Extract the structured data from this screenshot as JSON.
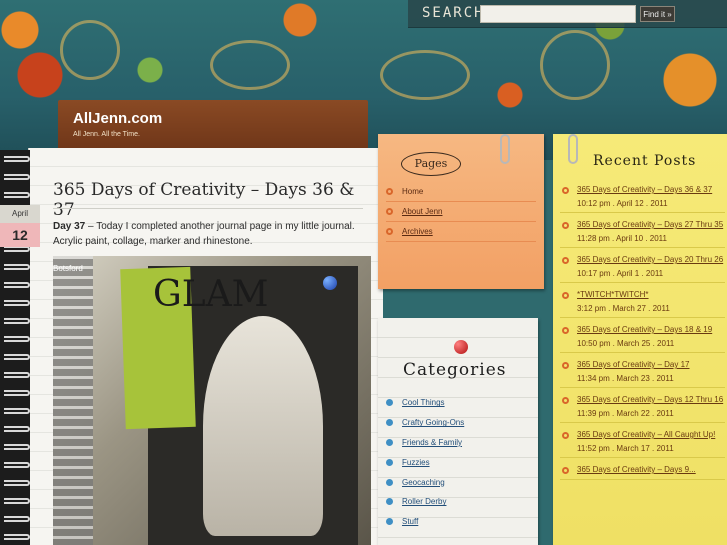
{
  "search": {
    "label": "SEARCH",
    "placeholder": "",
    "button": "Find it »"
  },
  "site": {
    "title": "AllJenn.com",
    "tagline": "All Jenn. All the Time."
  },
  "post": {
    "date_month": "April",
    "date_day": "12",
    "title": "365 Days of Creativity – Days 36 & 37",
    "body_lead": "Day 37",
    "body_text": " – Today I completed another journal page in my little journal. Acrylic paint, collage, marker and rhinestone.",
    "image_label": "Botsford",
    "image_word": "GLAM"
  },
  "pages": {
    "heading": "Pages",
    "items": [
      "Home",
      "About Jenn",
      "Archives"
    ]
  },
  "categories": {
    "heading": "Categories",
    "items": [
      "Cool Things",
      "Crafty Going-Ons",
      "Friends & Family",
      "Fuzzies",
      "Geocaching",
      "Roller Derby",
      "Stuff"
    ]
  },
  "recent_posts": {
    "heading": "Recent Posts",
    "items": [
      {
        "title": "365 Days of Creativity – Days 36 & 37",
        "date": "10:12 pm . April 12 . 2011"
      },
      {
        "title": "365 Days of Creativity – Days 27 Thru 35",
        "date": "11:28 pm . April 10 . 2011"
      },
      {
        "title": "365 Days of Creativity – Days 20 Thru 26",
        "date": "10:17 pm . April 1 . 2011"
      },
      {
        "title": "*TWITCH*TWITCH*",
        "date": "3:12 pm . March 27 . 2011"
      },
      {
        "title": "365 Days of Creativity – Days 18 & 19",
        "date": "10:50 pm . March 25 . 2011"
      },
      {
        "title": "365 Days of Creativity – Day 17",
        "date": "11:34 pm . March 23 . 2011"
      },
      {
        "title": "365 Days of Creativity – Days 12 Thru 16",
        "date": "11:39 pm . March 22 . 2011"
      },
      {
        "title": "365 Days of Creativity – All Caught Up!",
        "date": "11:52 pm . March 17 . 2011"
      },
      {
        "title": "365 Days of Creativity – Days 9...",
        "date": ""
      }
    ]
  }
}
